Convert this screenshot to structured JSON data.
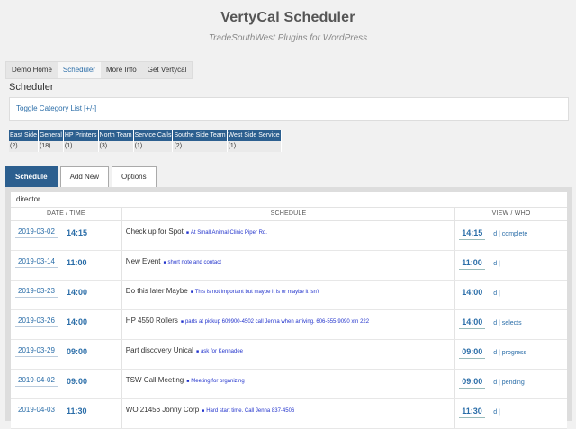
{
  "site": {
    "title": "VertyCal Scheduler",
    "description": "TradeSouthWest Plugins for WordPress"
  },
  "nav": [
    "Demo Home",
    "Scheduler",
    "More Info",
    "Get Vertycal"
  ],
  "page_title": "Scheduler",
  "toggle_label": "Toggle Category List   [+/-]",
  "categories": [
    {
      "name": "East Side",
      "count": "(2)"
    },
    {
      "name": "General",
      "count": "(18)"
    },
    {
      "name": "HP Printers",
      "count": "(1)"
    },
    {
      "name": "North Team",
      "count": "(3)"
    },
    {
      "name": "Service Calls",
      "count": "(1)"
    },
    {
      "name": "Southe Side Team",
      "count": "(2)"
    },
    {
      "name": "West Side Service",
      "count": "(1)"
    }
  ],
  "tabs": [
    "Schedule",
    "Add New",
    "Options"
  ],
  "director": "director",
  "table_headers": [
    "DATE / TIME",
    "SCHEDULE",
    "VIEW / WHO"
  ],
  "rows": [
    {
      "date": "2019-03-02",
      "start": "14:15",
      "title": "Check up for Spot",
      "note": "At Small Animal Clinic Piper Rd.",
      "time": "14:15",
      "who": "d | complete"
    },
    {
      "date": "2019-03-14",
      "start": "11:00",
      "title": "New Event",
      "note": "short note and contact",
      "time": "11:00",
      "who": "d |"
    },
    {
      "date": "2019-03-23",
      "start": "14:00",
      "title": "Do this later Maybe",
      "note": "This is not important but maybe it is or maybe it isn't",
      "time": "14:00",
      "who": "d |"
    },
    {
      "date": "2019-03-26",
      "start": "14:00",
      "title": "HP 4550 Rollers",
      "note": "parts at pickup 609900-4502 call Jenna when arriving. 606-555-9090 xtn 222",
      "time": "14:00",
      "who": "d | selects"
    },
    {
      "date": "2019-03-29",
      "start": "09:00",
      "title": "Part discovery Unical",
      "note": "ask for Kennadee",
      "time": "09:00",
      "who": "d | progress"
    },
    {
      "date": "2019-04-02",
      "start": "09:00",
      "title": "TSW Call Meeting",
      "note": "Meeting for organizing",
      "time": "09:00",
      "who": "d | pending"
    },
    {
      "date": "2019-04-03",
      "start": "11:30",
      "title": "WO 21456 Jonny Corp",
      "note": "Hard start time. Call Jenna 837-4506",
      "time": "11:30",
      "who": "d |"
    }
  ]
}
